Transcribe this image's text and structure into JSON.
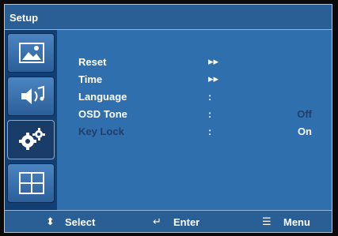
{
  "title": "Setup",
  "sidebar": {
    "items": [
      {
        "icon": "picture-icon"
      },
      {
        "icon": "audio-icon"
      },
      {
        "icon": "gear-icon",
        "active": true
      },
      {
        "icon": "grid-icon"
      }
    ]
  },
  "menu": {
    "rows": [
      {
        "label": "Reset",
        "sep": "▸▸",
        "value": ""
      },
      {
        "label": "Time",
        "sep": "▸▸",
        "value": ""
      },
      {
        "label": "Language",
        "sep": ":",
        "value": ""
      },
      {
        "label": "OSD Tone",
        "sep": ":",
        "value": "Off"
      },
      {
        "label": "Key Lock",
        "sep": ":",
        "value": "On"
      }
    ]
  },
  "footer": {
    "select_label": "Select",
    "enter_label": "Enter",
    "menu_label": "Menu"
  }
}
